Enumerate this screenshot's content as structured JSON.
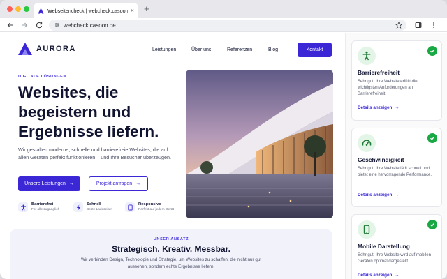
{
  "browser": {
    "tab_title": "Webseitencheck | webcheck.casoon.de",
    "tab_close": "×",
    "new_tab": "+",
    "url": "webcheck.casoon.de"
  },
  "site": {
    "logo_text": "AURORA",
    "nav": [
      "Leistungen",
      "Über uns",
      "Referenzen",
      "Blog"
    ],
    "cta": "Kontakt",
    "hero": {
      "eyebrow": "DIGITALE LÖSUNGEN",
      "title_lines": [
        "Websites, die",
        "begeistern und",
        "Ergebnisse liefern."
      ],
      "subtitle": "Wir gestalten moderne, schnelle und barrierefreie Websites, die auf allen Geräten perfekt funktionieren – und Ihre Besucher überzeugen.",
      "primary_button": "Unsere Leistungen",
      "secondary_button": "Projekt anfragen",
      "arrow": "→"
    },
    "features": [
      {
        "title": "Barrierefrei",
        "subtitle": "Für alle zugänglich",
        "icon": "accessibility-icon"
      },
      {
        "title": "Schnell",
        "subtitle": "Beste Ladezeiten",
        "icon": "lightning-icon"
      },
      {
        "title": "Responsive",
        "subtitle": "Perfekt auf jedem Gerät",
        "icon": "device-icon"
      }
    ],
    "approach": {
      "eyebrow": "UNSER ANSATZ",
      "title": "Strategisch. Kreativ. Messbar.",
      "text": "Wir verbinden Design, Technologie und Strategie, um Websites zu schaffen, die nicht nur gut aussehen, sondern echte Ergebnisse liefern."
    }
  },
  "checks": [
    {
      "title": "Barrierefreiheit",
      "text": "Sehr gut! Ihre Website erfüllt die wichtigsten Anforderungen an Barrierefreiheit.",
      "link": "Details anzeigen",
      "icon": "accessibility-icon",
      "status": "passed"
    },
    {
      "title": "Geschwindigkeit",
      "text": "Sehr gut! Ihre Website lädt schnell und bietet eine hervorragende Performance.",
      "link": "Details anzeigen",
      "icon": "speedometer-icon",
      "status": "passed"
    },
    {
      "title": "Mobile Darstellung",
      "text": "Sehr gut! Ihre Website wird auf mobilen Geräten optimal dargestellt.",
      "link": "Details anzeigen",
      "icon": "smartphone-icon",
      "status": "passed"
    }
  ],
  "colors": {
    "brand": "#3b27d6",
    "success": "#19a843",
    "heading": "#111430"
  }
}
